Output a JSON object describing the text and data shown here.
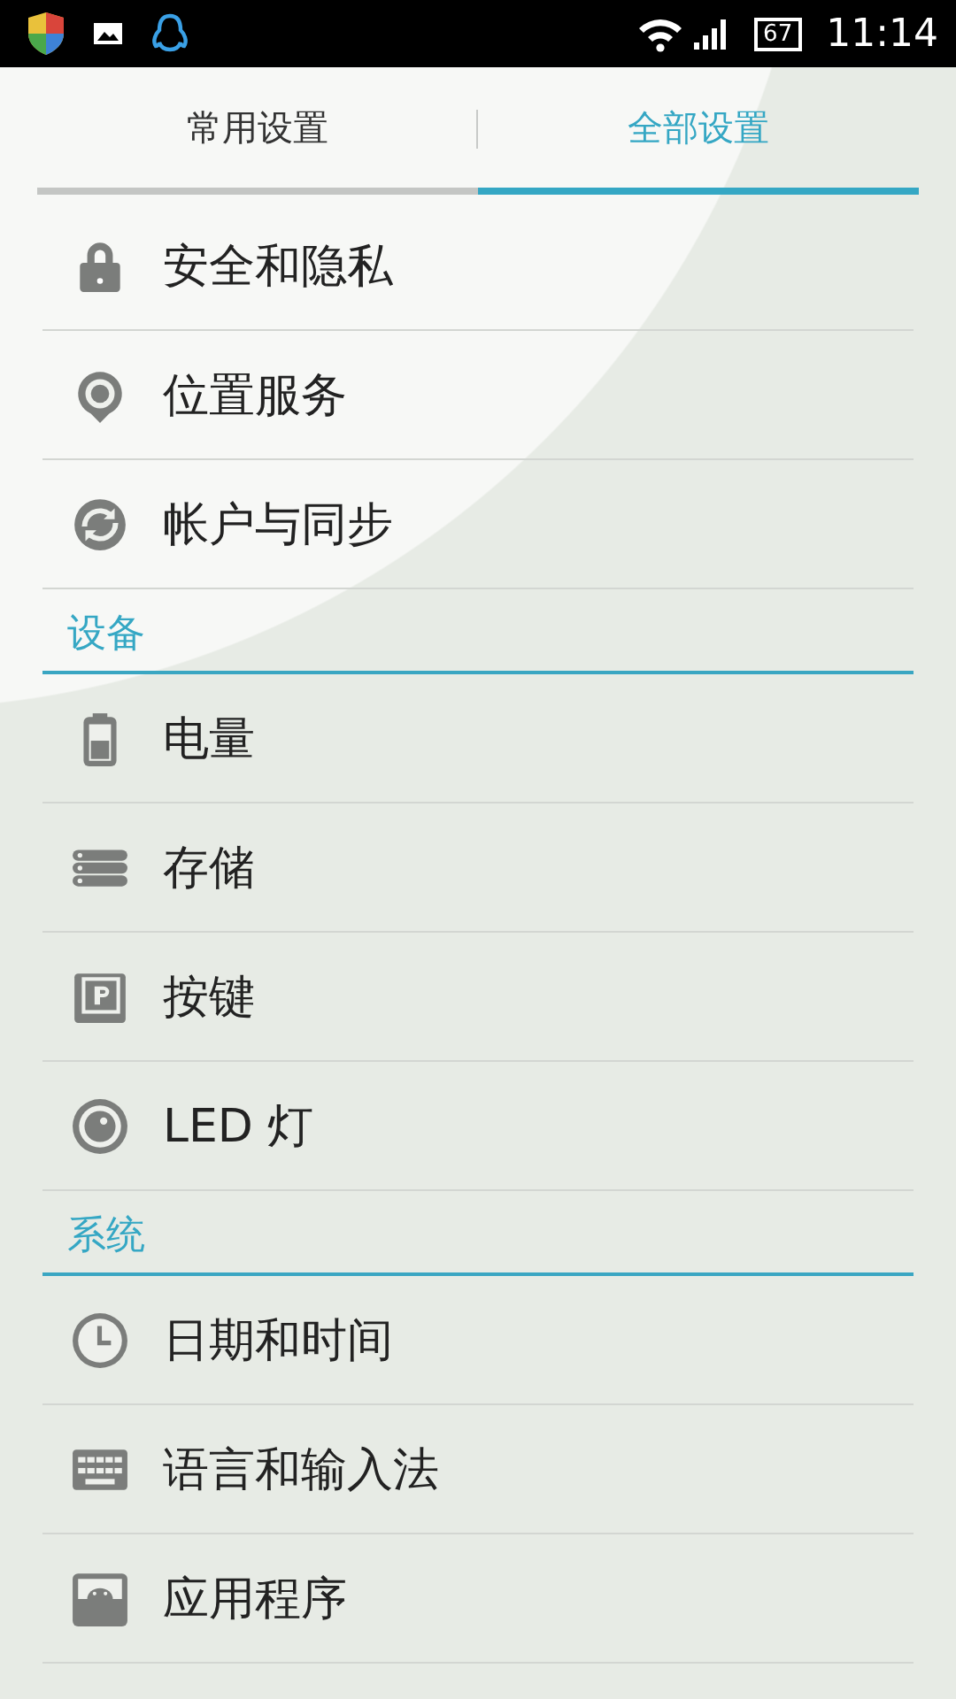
{
  "status_bar": {
    "battery": "67",
    "time": "11:14"
  },
  "tabs": [
    {
      "label": "常用设置",
      "selected": false
    },
    {
      "label": "全部设置",
      "selected": true
    }
  ],
  "sections": [
    {
      "items": [
        {
          "label": "安全和隐私",
          "kind": "lock"
        },
        {
          "label": "位置服务",
          "kind": "pin"
        },
        {
          "label": "帐户与同步",
          "kind": "sync"
        }
      ]
    },
    {
      "title": "设备",
      "items": [
        {
          "label": "电量",
          "kind": "battery"
        },
        {
          "label": "存储",
          "kind": "storage"
        },
        {
          "label": "按键",
          "kind": "keycap"
        },
        {
          "label": "LED 灯",
          "kind": "led"
        }
      ]
    },
    {
      "title": "系统",
      "items": [
        {
          "label": "日期和时间",
          "kind": "clock"
        },
        {
          "label": "语言和输入法",
          "kind": "keyboard"
        },
        {
          "label": "应用程序",
          "kind": "app"
        }
      ]
    }
  ]
}
